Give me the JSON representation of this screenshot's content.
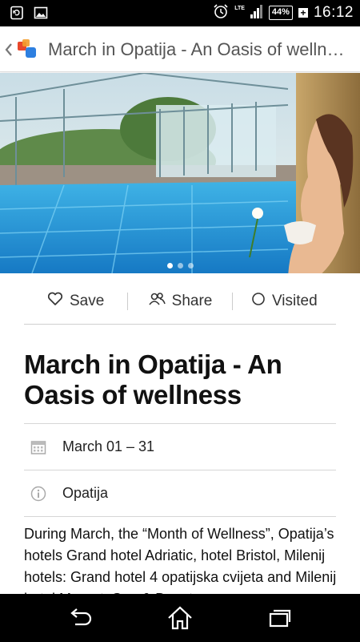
{
  "status_bar": {
    "network": "LTE",
    "battery": "44%",
    "time": "16:12"
  },
  "app_bar": {
    "title": "March in Opatija - An Oasis of wellness"
  },
  "hero": {
    "slide_count": 3,
    "active_slide": 0
  },
  "actions": {
    "save_label": "Save",
    "share_label": "Share",
    "visited_label": "Visited"
  },
  "event": {
    "title": "March in Opatija - An Oasis of wellness",
    "date": "March 01 – 31",
    "location": "Opatija",
    "description": "During March, the “Month of Wellness”, Opatija’s hotels Grand hotel Adriatic, hotel Bristol, Milenij hotels: Grand hotel 4 opatijska cvijeta and Milenij hotel Margot, Spa & Beauty"
  },
  "colors": {
    "status_bar": "#000000",
    "nav_bar": "#000000",
    "title_text": "#111111",
    "app_bar_title": "#555555",
    "divider": "#d6d6d6",
    "logo_blue": "#2d7fe0",
    "logo_red": "#e8472b"
  },
  "icons": {
    "status_left": [
      "screen-rotation-icon",
      "image-icon"
    ],
    "status_right": [
      "alarm-clock-icon",
      "signal-icon",
      "battery-icon",
      "charging-plus-icon"
    ],
    "actions": [
      "heart-outline-icon",
      "people-icon",
      "circle-outline-icon"
    ],
    "info": [
      "calendar-icon",
      "info-icon"
    ],
    "nav": [
      "back-nav-icon",
      "home-nav-icon",
      "recents-nav-icon"
    ]
  }
}
